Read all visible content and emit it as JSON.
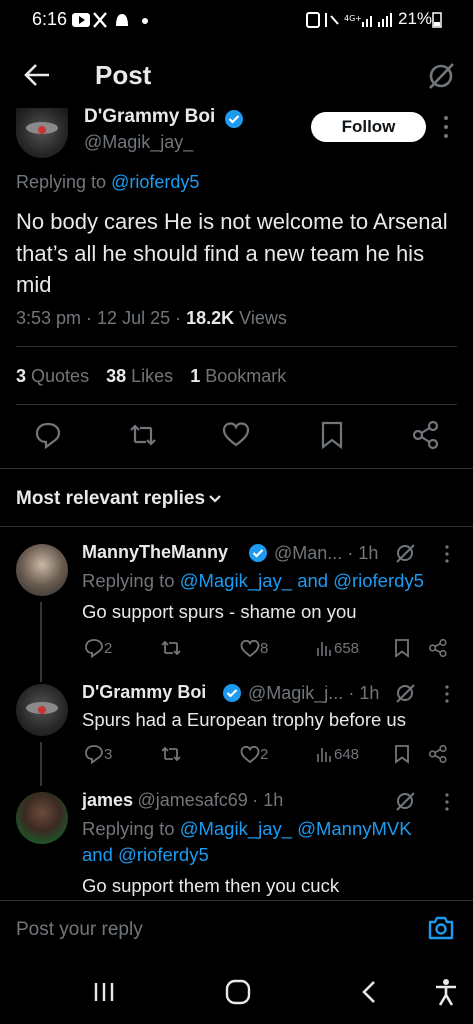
{
  "status_bar": {
    "time": "6:16",
    "battery": "21%"
  },
  "header": {
    "title": "Post"
  },
  "main_tweet": {
    "name": "D'Grammy Boi",
    "handle": "@Magik_jay_",
    "follow_label": "Follow",
    "replying_prefix": "Replying to",
    "replying_to": "@rioferdy5",
    "text": "No body cares He is not welcome to Arsenal that’s all he should find a new team he his mid",
    "time": "3:53 pm",
    "date": "12 Jul 25",
    "views_count": "18.2K",
    "views_label": "Views",
    "quotes_count": "3",
    "quotes_label": "Quotes",
    "likes_count": "38",
    "likes_label": "Likes",
    "bookmarks_count": "1",
    "bookmarks_label": "Bookmark"
  },
  "sort": {
    "label": "Most relevant replies"
  },
  "replies": [
    {
      "name": "MannyTheManny",
      "handle": "@Man...",
      "time": "· 1h",
      "replying_prefix": "Replying to",
      "replying_to": "@Magik_jay_ and @rioferdy5",
      "text": "Go support spurs - shame on you",
      "replies": "2",
      "reposts": "",
      "likes": "8",
      "views": "658"
    },
    {
      "name": "D'Grammy Boi",
      "handle": "@Magik_j...",
      "time": "· 1h",
      "text": "Spurs had a European trophy before us",
      "replies": "3",
      "reposts": "",
      "likes": "2",
      "views": "648"
    },
    {
      "name": "james",
      "handle": "@jamesafc69",
      "time": "· 1h",
      "replying_prefix": "Replying to",
      "replying_to_line1": "@Magik_jay_ @MannyMVK",
      "replying_to_line2": "and @rioferdy5",
      "text": "Go support them then you cuck"
    }
  ],
  "reply_bar": {
    "placeholder": "Post your reply"
  },
  "colors": {
    "accent": "#1d9bf0",
    "muted": "#71767b",
    "text": "#e7e9ea",
    "background": "#000000"
  }
}
